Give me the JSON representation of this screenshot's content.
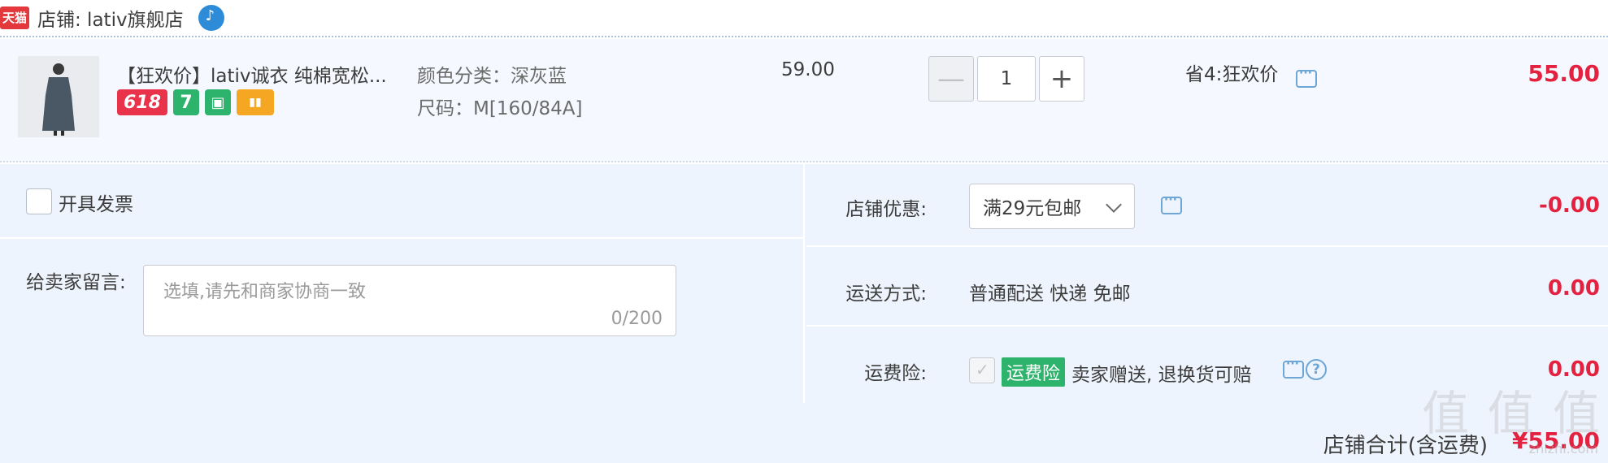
{
  "shop": {
    "badge": "天猫",
    "name": "店铺: lativ旗舰店"
  },
  "item": {
    "title": "【狂欢价】lativ诚衣 纯棉宽松...",
    "promo_icons": [
      "618",
      "7",
      "bag-icon",
      "card-icon"
    ],
    "sku_color": "颜色分类：深灰蓝",
    "sku_size": "尺码：M[160/84A]",
    "price": "59.00",
    "quantity": "1",
    "qty_minus": "—",
    "qty_plus": "+",
    "save_text": "省4:狂欢价",
    "subtotal": "55.00"
  },
  "invoice": {
    "label": "开具发票"
  },
  "message": {
    "label": "给卖家留言:",
    "placeholder": "选填,请先和商家协商一致",
    "count": "0/200"
  },
  "discount": {
    "label": "店铺优惠:",
    "selected": "满29元包邮",
    "amount": "-0.00"
  },
  "shipping": {
    "label": "运送方式:",
    "text": "普通配送 快递 免邮",
    "amount": "0.00"
  },
  "insurance": {
    "label": "运费险:",
    "badge": "运费险",
    "text": "卖家赠送, 退换货可赔",
    "amount": "0.00"
  },
  "total": {
    "label": "店铺合计(含运费)",
    "amount": "¥55.00"
  },
  "watermark": {
    "main": "值 值 值",
    "sub": "zhizhi.com"
  },
  "colors": {
    "accent_red": "#e4213f",
    "tmall_red": "#e4393c",
    "green_badge": "#2db36b",
    "link_blue": "#6ea6d6"
  }
}
